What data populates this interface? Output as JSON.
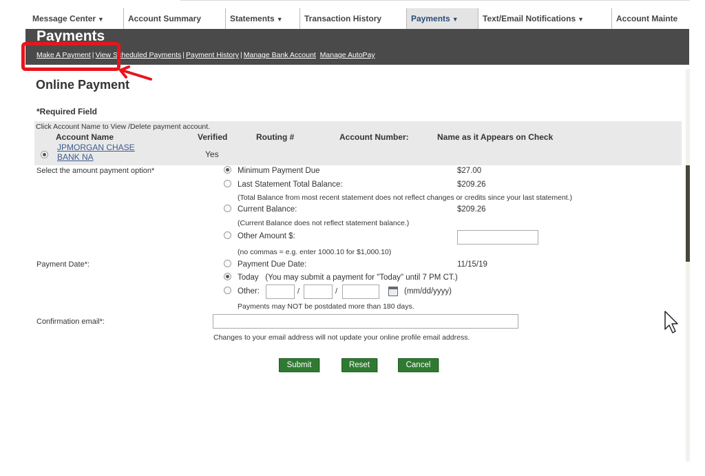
{
  "top_nav": {
    "tabs": [
      {
        "label": "Message Center",
        "dropdown": true
      },
      {
        "label": "Account Summary",
        "dropdown": false
      },
      {
        "label": "Statements",
        "dropdown": true
      },
      {
        "label": "Transaction History",
        "dropdown": false
      },
      {
        "label": "Payments",
        "dropdown": true,
        "active": true
      },
      {
        "label": "Text/Email Notifications",
        "dropdown": true
      },
      {
        "label": "Account Mainte",
        "dropdown": false
      }
    ],
    "dropdown_arrow": "▼"
  },
  "header": {
    "title": "Payments",
    "subnav": {
      "make_payment": "Make A Payment",
      "view_scheduled": "View Scheduled Payments",
      "history": "Payment History",
      "bank_account": "Manage Bank Account",
      "autopay": "Manage AutoPay",
      "separator": "|"
    }
  },
  "page": {
    "title": "Online Payment",
    "required_note": "*Required Field"
  },
  "accounts": {
    "hint": "Click Account Name to View /Delete payment account.",
    "columns": {
      "name": "Account Name",
      "verified": "Verified",
      "routing": "Routing #",
      "number": "Account Number:",
      "check_name": "Name as it Appears on Check"
    },
    "row": {
      "name_line1": "JPMORGAN CHASE",
      "name_line2": "BANK NA",
      "verified": "Yes",
      "selected": true
    }
  },
  "amount": {
    "label": "Select the amount payment option*",
    "options": [
      {
        "label": "Minimum Payment Due",
        "amount": "$27.00",
        "selected": true
      },
      {
        "label": "Last Statement Total Balance:",
        "amount": "$209.26",
        "selected": false
      },
      {
        "label": "Current Balance:",
        "amount": "$209.26",
        "selected": false
      },
      {
        "label": "Other Amount $:",
        "amount": "",
        "selected": false
      }
    ],
    "notes": {
      "last_statement": "(Total Balance from most recent statement does not reflect changes or credits since your last statement.)",
      "current": "(Current Balance does not reflect statement balance.)",
      "other": "(no commas = e.g. enter 1000.10 for $1,000.10)"
    },
    "other_value": ""
  },
  "payment_date": {
    "label": "Payment Date*:",
    "due_label": "Payment Due Date:",
    "due_value": "11/15/19",
    "today_label": "Today",
    "today_note": "(You may submit a payment for \"Today\" until 7 PM CT.)",
    "other_label": "Other:",
    "other_mm": "",
    "other_dd": "",
    "other_yyyy": "",
    "date_format": "(mm/dd/yyyy)",
    "slash": "/",
    "postdate_note": "Payments may NOT be postdated more than 180 days.",
    "selected": "today"
  },
  "confirmation": {
    "label": "Confirmation email*:",
    "value": "",
    "note": "Changes to your email address will not update your online profile email address."
  },
  "buttons": {
    "submit": "Submit",
    "reset": "Reset",
    "cancel": "Cancel"
  },
  "colors": {
    "header_band": "#4a4a4a",
    "button_green": "#2f7a32",
    "link_blue": "#3b5b8f",
    "annotation_red": "#e8141c"
  }
}
